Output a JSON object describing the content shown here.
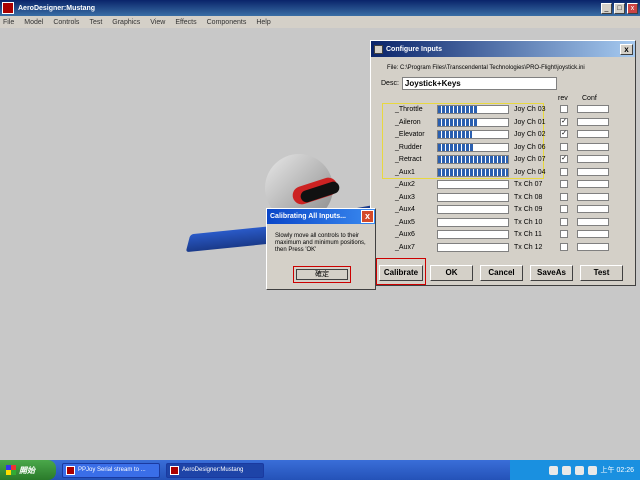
{
  "app": {
    "title": "AeroDesigner:Mustang",
    "ctrls": [
      "_",
      "□",
      "x"
    ],
    "menu": [
      "File",
      "Model",
      "Controls",
      "Test",
      "Graphics",
      "View",
      "Effects",
      "Components",
      "Help"
    ]
  },
  "config": {
    "title": "Configure Inputs",
    "close": "x",
    "file_label": "File:",
    "file_path": "C:\\Program Files\\Transcendental Technologies\\PRO-Flight\\joystick.ini",
    "desc_label": "Desc:",
    "desc_value": "Joystick+Keys",
    "rev_header": "rev",
    "conf_header": "Conf",
    "rows": [
      {
        "label": "Throttle",
        "channel": "Joy Ch 03",
        "level": 0.55,
        "rev": false
      },
      {
        "label": "Aileron",
        "channel": "Joy Ch 01",
        "level": 0.55,
        "rev": true
      },
      {
        "label": "Elevator",
        "channel": "Joy Ch 02",
        "level": 0.48,
        "rev": true
      },
      {
        "label": "Rudder",
        "channel": "Joy Ch 06",
        "level": 0.5,
        "rev": false
      },
      {
        "label": "Retract",
        "channel": "Joy Ch 07",
        "level": 1.0,
        "rev": true
      },
      {
        "label": "Aux1",
        "channel": "Joy Ch 04",
        "level": 1.0,
        "rev": false
      },
      {
        "label": "Aux2",
        "channel": "Tx Ch 07",
        "level": 0,
        "rev": false
      },
      {
        "label": "Aux3",
        "channel": "Tx Ch 08",
        "level": 0,
        "rev": false
      },
      {
        "label": "Aux4",
        "channel": "Tx Ch 09",
        "level": 0,
        "rev": false
      },
      {
        "label": "Aux5",
        "channel": "Tx Ch 10",
        "level": 0,
        "rev": false
      },
      {
        "label": "Aux6",
        "channel": "Tx Ch 11",
        "level": 0,
        "rev": false
      },
      {
        "label": "Aux7",
        "channel": "Tx Ch 12",
        "level": 0,
        "rev": false
      }
    ],
    "buttons": {
      "calibrate": "Calibrate",
      "ok": "OK",
      "cancel": "Cancel",
      "saveas": "SaveAs",
      "test": "Test"
    }
  },
  "dialog": {
    "title": "Calibrating All Inputs...",
    "close": "x",
    "message": "Slowly move all controls to their maximum and minimum positions, then Press 'OK'",
    "ok_label": "確定"
  },
  "taskbar": {
    "start_label": "開始",
    "tasks": [
      "PPJoy Serial stream to ...",
      "AeroDesigner:Mustang"
    ],
    "clock": "上午 02:26"
  },
  "colors": {
    "accent": "#0a246a",
    "progress": "#2a5fb0",
    "highlight": "#e8d840",
    "callout": "#cc0000"
  }
}
